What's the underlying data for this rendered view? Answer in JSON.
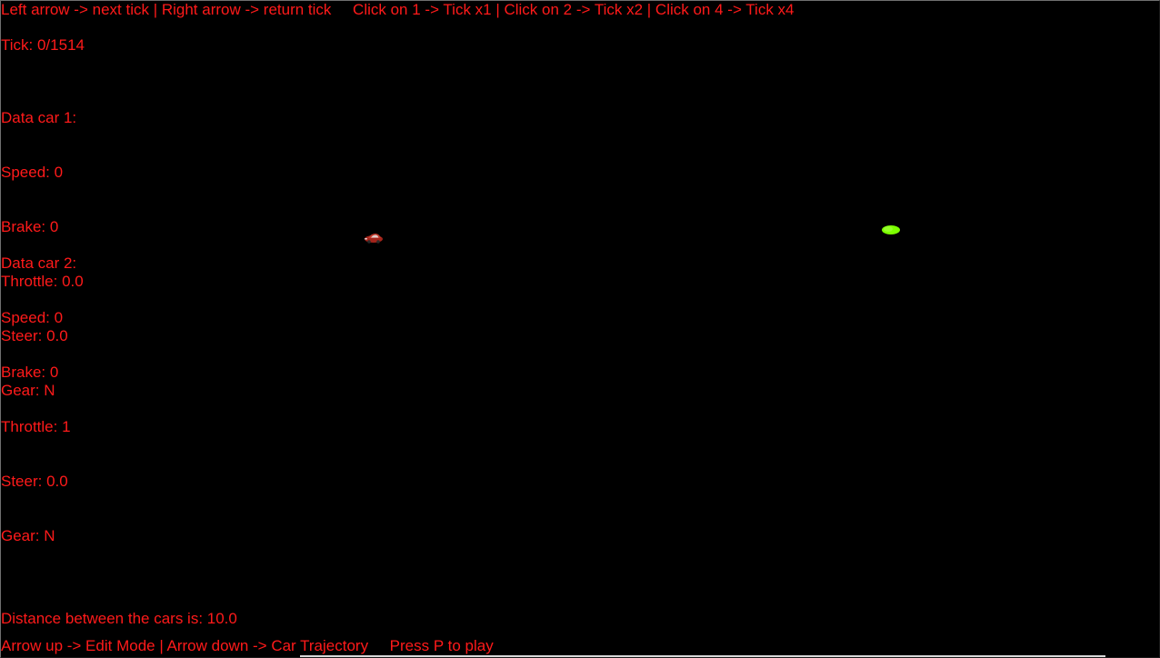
{
  "hints": {
    "top": "Left arrow -> next tick | Right arrow -> return tick     Click on 1 -> Tick x1 | Click on 2 -> Tick x2 | Click on 4 -> Tick x4",
    "bottom": "Arrow up -> Edit Mode | Arrow down -> Car Trajectory     Press P to play"
  },
  "tick": "Tick: 0/1514",
  "car1": {
    "header": "Data car 1:",
    "speed": "Speed: 0",
    "brake": "Brake: 0",
    "throttle": "Throttle: 0.0",
    "steer": "Steer: 0.0",
    "gear": "Gear: N"
  },
  "car2": {
    "header": "Data car 2:",
    "speed": "Speed: 0",
    "brake": "Brake: 0",
    "throttle": "Throttle: 1",
    "steer": "Steer: 0.0",
    "gear": "Gear: N"
  },
  "distance": "Distance between the cars is: 10.0",
  "colors": {
    "background": "#000000",
    "text": "#ff1a1a",
    "car1": "#c0392b",
    "car2": "#7cff00"
  }
}
